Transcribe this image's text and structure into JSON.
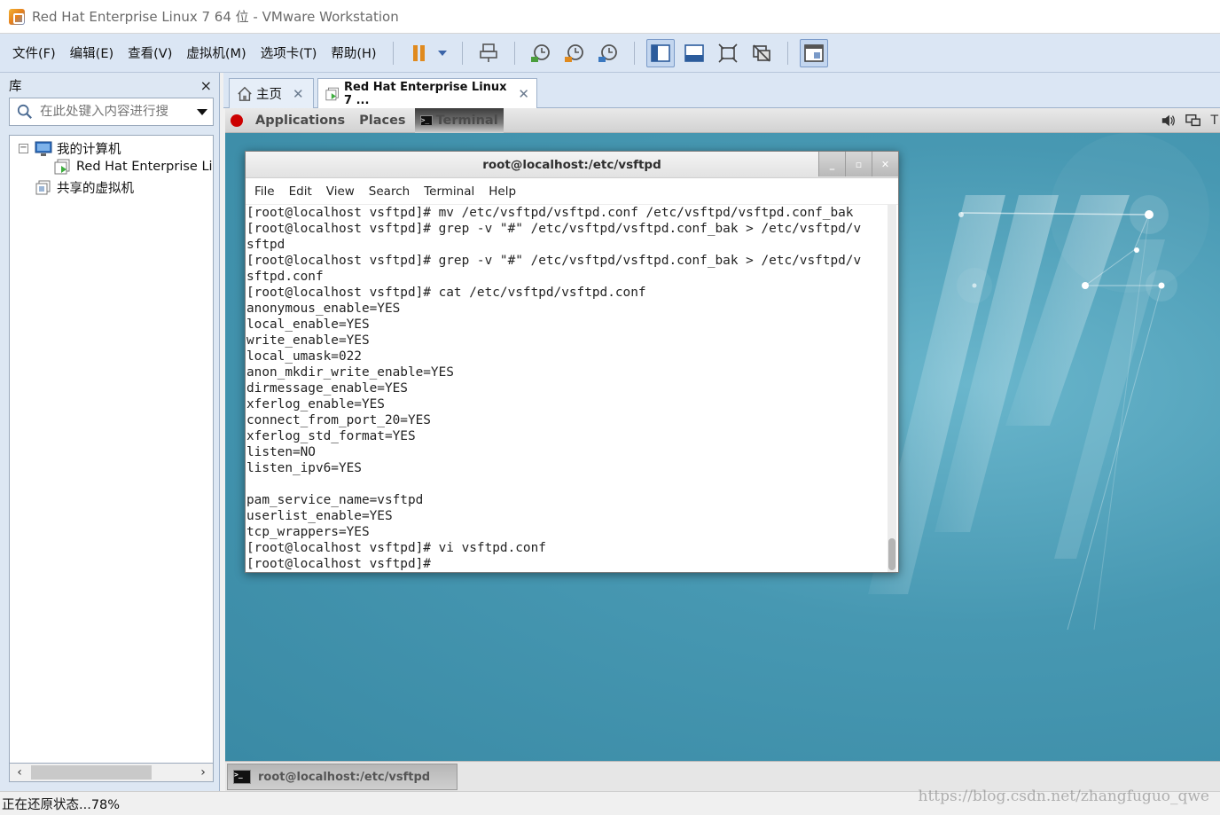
{
  "window": {
    "title": "Red Hat Enterprise Linux 7 64 位 - VMware Workstation"
  },
  "menubar": {
    "items": [
      "文件(F)",
      "编辑(E)",
      "查看(V)",
      "虚拟机(M)",
      "选项卡(T)",
      "帮助(H)"
    ]
  },
  "toolbar": {
    "icons": [
      "pause-icon",
      "dropdown-arrow-icon",
      "send-ctrl-alt-del-icon",
      "snapshot-take-icon",
      "snapshot-revert-icon",
      "snapshot-manager-icon",
      "view-sidebar-icon",
      "view-thumbnail-icon",
      "fullscreen-icon",
      "unity-icon",
      "console-view-icon"
    ]
  },
  "library": {
    "title": "库",
    "close": "×",
    "search_placeholder": "在此处键入内容进行搜",
    "tree": {
      "my_computer": "我的计算机",
      "vm_item": "Red Hat Enterprise Li",
      "shared_vms": "共享的虚拟机"
    }
  },
  "tabs": [
    {
      "label": "主页",
      "icon": "home-icon",
      "close": "✕"
    },
    {
      "label": "Red Hat Enterprise Linux 7 ...",
      "icon": "vm-running-icon",
      "close": "✕"
    }
  ],
  "gnome_panel": {
    "applications": "Applications",
    "places": "Places",
    "terminal": "Terminal",
    "right_icons": [
      "volume-icon",
      "network-icon"
    ],
    "right_clip": "T"
  },
  "terminal": {
    "title": "root@localhost:/etc/vsftpd",
    "menu": [
      "File",
      "Edit",
      "View",
      "Search",
      "Terminal",
      "Help"
    ],
    "lines": [
      "[root@localhost vsftpd]# mv /etc/vsftpd/vsftpd.conf /etc/vsftpd/vsftpd.conf_bak",
      "[root@localhost vsftpd]# grep -v \"#\" /etc/vsftpd/vsftpd.conf_bak > /etc/vsftpd/v",
      "sftpd",
      "[root@localhost vsftpd]# grep -v \"#\" /etc/vsftpd/vsftpd.conf_bak > /etc/vsftpd/v",
      "sftpd.conf",
      "[root@localhost vsftpd]# cat /etc/vsftpd/vsftpd.conf",
      "anonymous_enable=YES",
      "local_enable=YES",
      "write_enable=YES",
      "local_umask=022",
      "anon_mkdir_write_enable=YES",
      "dirmessage_enable=YES",
      "xferlog_enable=YES",
      "connect_from_port_20=YES",
      "xferlog_std_format=YES",
      "listen=NO",
      "listen_ipv6=YES",
      "",
      "pam_service_name=vsftpd",
      "userlist_enable=YES",
      "tcp_wrappers=YES",
      "[root@localhost vsftpd]# vi vsftpd.conf",
      "[root@localhost vsftpd]# "
    ]
  },
  "taskbar": {
    "item": "root@localhost:/etc/vsftpd"
  },
  "statusbar": {
    "text": "正在还原状态...78%"
  },
  "watermark": "https://blog.csdn.net/zhangfuguo_qwe",
  "colors": {
    "vmware_chrome": "#dbe6f4",
    "desktop": "#3f92ab",
    "redhat_red": "#cc0000"
  }
}
